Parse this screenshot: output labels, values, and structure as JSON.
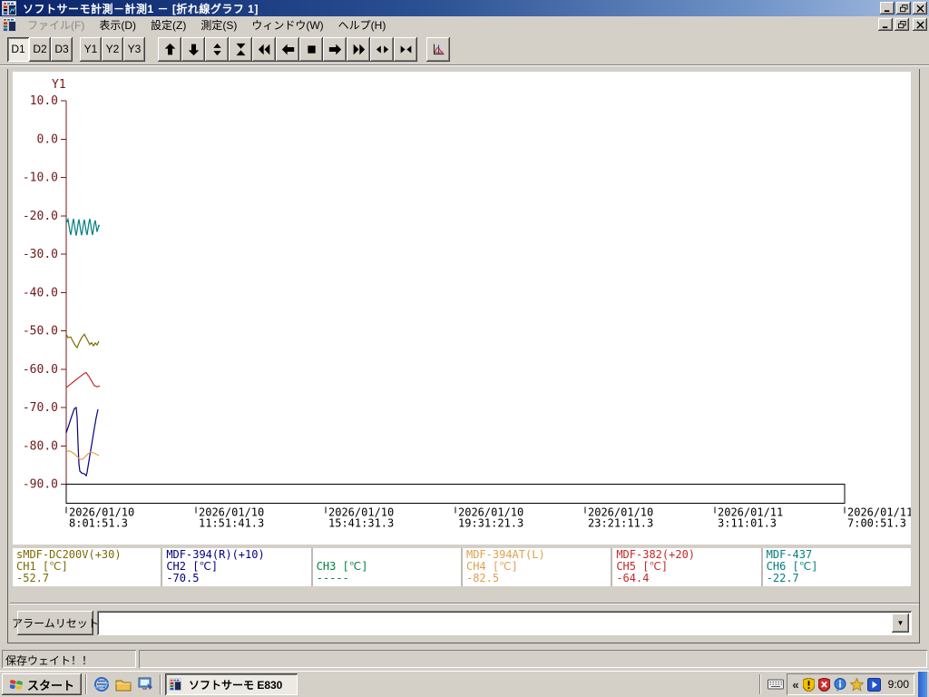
{
  "titlebar": {
    "title": "ソフトサーモ計測－計測1 － [折れ線グラフ 1]"
  },
  "menubar": {
    "items": [
      {
        "label": "ファイル(F)",
        "enabled": false
      },
      {
        "label": "表示(D)",
        "enabled": true
      },
      {
        "label": "設定(Z)",
        "enabled": true
      },
      {
        "label": "測定(S)",
        "enabled": true
      },
      {
        "label": "ウィンドウ(W)",
        "enabled": true
      },
      {
        "label": "ヘルプ(H)",
        "enabled": true
      }
    ]
  },
  "toolbar": {
    "text_buttons": [
      "D1",
      "D2",
      "D3",
      "Y1",
      "Y2",
      "Y3"
    ],
    "active_button": "D1",
    "icon_buttons": [
      "scroll-up",
      "scroll-down",
      "expand-vertical",
      "compress-vertical",
      "fast-rewind",
      "step-left",
      "stop",
      "step-right",
      "fast-forward",
      "expand-horizontal",
      "compress-horizontal",
      "graph-settings"
    ]
  },
  "chart_data": {
    "type": "line",
    "title": "折れ線グラフ 1",
    "grid": false,
    "y_axis": {
      "label": "Y1",
      "max": 10.0,
      "min": -90.0,
      "tick_step": 10.0,
      "color": "#701818",
      "tick_labels": [
        "10.0",
        "0.0",
        "-10.0",
        "-20.0",
        "-30.0",
        "-40.0",
        "-50.0",
        "-60.0",
        "-70.0",
        "-80.0",
        "-90.0"
      ]
    },
    "x_axis": {
      "tick_labels": [
        {
          "date": "2026/01/10",
          "time": "8:01:51.3"
        },
        {
          "date": "2026/01/10",
          "time": "11:51:41.3"
        },
        {
          "date": "2026/01/10",
          "time": "15:41:31.3"
        },
        {
          "date": "2026/01/10",
          "time": "19:31:21.3"
        },
        {
          "date": "2026/01/10",
          "time": "23:21:11.3"
        },
        {
          "date": "2026/01/11",
          "time": "3:11:01.3"
        },
        {
          "date": "2026/01/11",
          "time": "7:00:51.3"
        }
      ]
    },
    "series": [
      {
        "name": "sMDF-DC200V(+30)",
        "channel": "CH1",
        "unit": "[℃]",
        "value": "-52.7",
        "color": "#7A6A00",
        "points": [
          [
            0,
            -50.9
          ],
          [
            2,
            -51.8
          ],
          [
            5,
            -51.6
          ],
          [
            7,
            -52.6
          ],
          [
            10,
            -53.8
          ],
          [
            12,
            -54.4
          ],
          [
            14,
            -53.2
          ],
          [
            17,
            -51.8
          ],
          [
            20,
            -50.9
          ],
          [
            22,
            -51.8
          ],
          [
            24,
            -52.7
          ],
          [
            26,
            -53.6
          ],
          [
            28,
            -53.1
          ],
          [
            30,
            -53.9
          ],
          [
            32,
            -53.2
          ],
          [
            34,
            -53.7
          ],
          [
            36,
            -52.7
          ]
        ]
      },
      {
        "name": "MDF-394(R)(+10)",
        "channel": "CH2",
        "unit": "[℃]",
        "value": "-70.5",
        "color": "#000080",
        "points": [
          [
            0,
            -76.6
          ],
          [
            3,
            -74.5
          ],
          [
            6,
            -72.3
          ],
          [
            9,
            -70.3
          ],
          [
            11,
            -70.0
          ],
          [
            12,
            -72.6
          ],
          [
            13,
            -79.5
          ],
          [
            14,
            -84.7
          ],
          [
            15,
            -86.6
          ],
          [
            17,
            -87.1
          ],
          [
            20,
            -87.3
          ],
          [
            22,
            -87.8
          ],
          [
            23,
            -86.9
          ],
          [
            25,
            -84.0
          ],
          [
            27,
            -81.1
          ],
          [
            29,
            -78.3
          ],
          [
            31,
            -75.4
          ],
          [
            33,
            -72.7
          ],
          [
            35,
            -70.5
          ]
        ]
      },
      {
        "name": "",
        "channel": "CH3",
        "unit": "[℃]",
        "value": "-----",
        "color": "#008040",
        "points": []
      },
      {
        "name": "MDF-394AT(L)",
        "channel": "CH4",
        "unit": "[℃]",
        "value": "-82.5",
        "color": "#DFA050",
        "points": [
          [
            0,
            -81.6
          ],
          [
            3,
            -81.3
          ],
          [
            6,
            -81.6
          ],
          [
            9,
            -82.1
          ],
          [
            12,
            -82.8
          ],
          [
            15,
            -83.5
          ],
          [
            18,
            -83.5
          ],
          [
            21,
            -82.8
          ],
          [
            24,
            -82.1
          ],
          [
            27,
            -81.6
          ],
          [
            30,
            -81.8
          ],
          [
            33,
            -82.2
          ],
          [
            36,
            -82.5
          ]
        ]
      },
      {
        "name": "MDF-382(+20)",
        "channel": "CH5",
        "unit": "[℃]",
        "value": "-64.4",
        "color": "#C42828",
        "points": [
          [
            0,
            -64.8
          ],
          [
            5,
            -63.9
          ],
          [
            10,
            -62.9
          ],
          [
            15,
            -62.0
          ],
          [
            20,
            -61.1
          ],
          [
            22,
            -60.9
          ],
          [
            25,
            -61.9
          ],
          [
            28,
            -63.1
          ],
          [
            31,
            -64.3
          ],
          [
            34,
            -64.6
          ],
          [
            37,
            -64.4
          ]
        ]
      },
      {
        "name": "MDF-437",
        "channel": "CH6",
        "unit": "[℃]",
        "value": "-22.7",
        "color": "#007E7E",
        "points": [
          [
            0,
            -21.0
          ],
          [
            1,
            -21.5
          ],
          [
            2,
            -20.9
          ],
          [
            3,
            -22.5
          ],
          [
            4,
            -24.0
          ],
          [
            5,
            -25.0
          ],
          [
            6,
            -23.5
          ],
          [
            7,
            -22.0
          ],
          [
            8,
            -20.8
          ],
          [
            9,
            -22.3
          ],
          [
            10,
            -23.8
          ],
          [
            11,
            -25.2
          ],
          [
            12,
            -23.8
          ],
          [
            13,
            -22.2
          ],
          [
            14,
            -20.9
          ],
          [
            15,
            -22.4
          ],
          [
            16,
            -24.0
          ],
          [
            17,
            -25.1
          ],
          [
            18,
            -23.6
          ],
          [
            19,
            -22.1
          ],
          [
            20,
            -21.0
          ],
          [
            21,
            -22.6
          ],
          [
            22,
            -24.1
          ],
          [
            23,
            -25.0
          ],
          [
            24,
            -23.4
          ],
          [
            25,
            -21.8
          ],
          [
            26,
            -20.8
          ],
          [
            27,
            -22.3
          ],
          [
            28,
            -23.9
          ],
          [
            29,
            -25.0
          ],
          [
            30,
            -23.5
          ],
          [
            31,
            -22.0
          ],
          [
            32,
            -21.2
          ],
          [
            33,
            -22.7
          ],
          [
            34,
            -24.2
          ],
          [
            35,
            -23.3
          ],
          [
            36,
            -22.5
          ],
          [
            37,
            -22.7
          ]
        ]
      }
    ]
  },
  "alarm_bar": {
    "reset_button": "アラームリセット",
    "combo_value": ""
  },
  "statusbar": {
    "message": "保存ウェイト！！",
    "right_panel": ""
  },
  "taskbar": {
    "start_label": "スタート",
    "task_button": "ソフトサーモ  E830",
    "clock": "9:00",
    "chevron": "«"
  }
}
